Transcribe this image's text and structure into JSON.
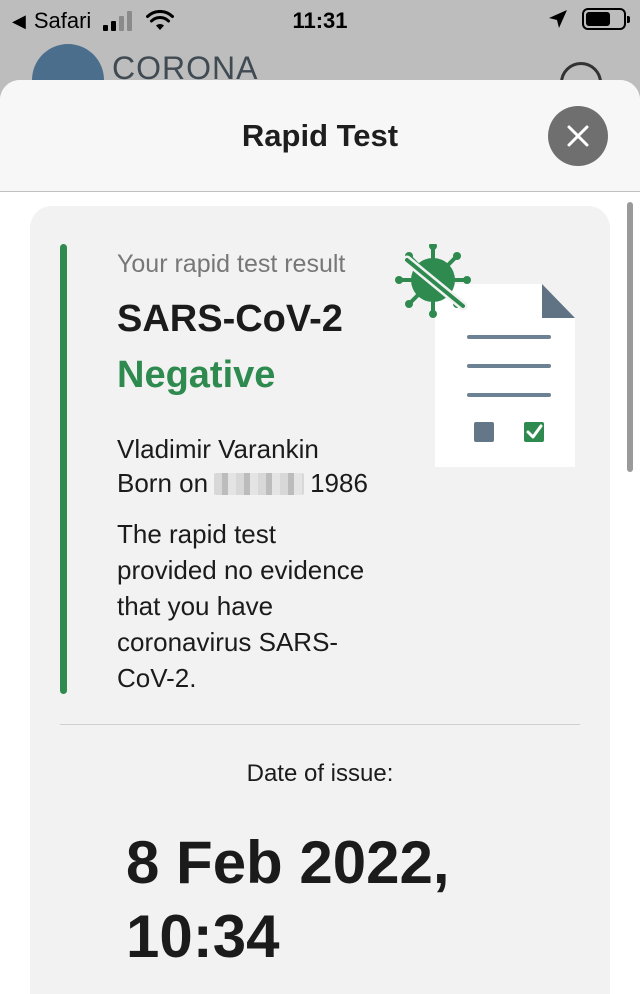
{
  "status_bar": {
    "back_app": "Safari",
    "time": "11:31"
  },
  "background_app": {
    "name": "CORONA"
  },
  "sheet": {
    "title": "Rapid Test",
    "close_icon": "close-icon"
  },
  "result": {
    "caption": "Your rapid test result",
    "virus": "SARS-CoV-2",
    "status": "Negative",
    "status_color": "#2e8a4f",
    "person_name": "Vladimir Varankin",
    "birth_prefix": "Born on",
    "birth_year": "1986",
    "description": "The rapid test provided no evidence that you have coronavirus SARS-CoV-2."
  },
  "issue": {
    "label": "Date of issue:",
    "value": "8 Feb 2022, 10:34"
  },
  "icons": [
    "back-arrow-icon",
    "signal-icon",
    "wifi-icon",
    "location-icon",
    "battery-icon",
    "virus-icon",
    "document-icon",
    "checkbox-icon"
  ]
}
